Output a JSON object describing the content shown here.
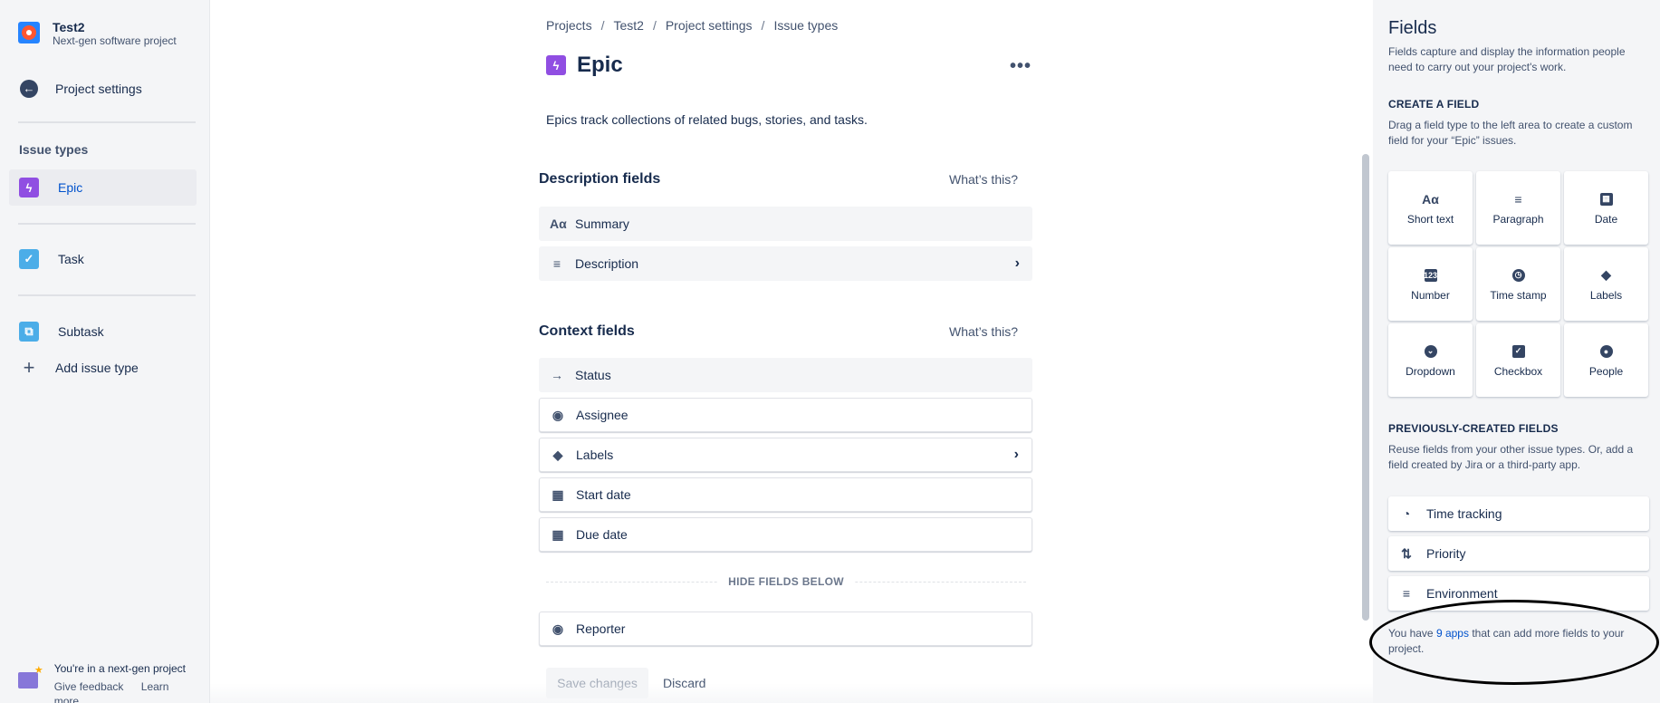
{
  "project": {
    "name": "Test2",
    "type": "Next-gen software project"
  },
  "sidebar": {
    "back_label": "Project settings",
    "issue_types_heading": "Issue types",
    "items": [
      {
        "label": "Epic",
        "icon": "epic-icon"
      },
      {
        "label": "Task",
        "icon": "task-icon"
      },
      {
        "label": "Subtask",
        "icon": "subtask-icon"
      }
    ],
    "add_label": "Add issue type",
    "footer": {
      "title": "You're in a next-gen project",
      "feedback": "Give feedback",
      "learn": "Learn more"
    }
  },
  "breadcrumbs": [
    "Projects",
    "Test2",
    "Project settings",
    "Issue types"
  ],
  "main": {
    "title": "Epic",
    "description": "Epics track collections of related bugs, stories, and tasks.",
    "description_section": {
      "heading": "Description fields",
      "help": "What’s this?"
    },
    "description_fields": [
      "Summary",
      "Description"
    ],
    "context_section": {
      "heading": "Context fields",
      "help": "What’s this?"
    },
    "context_fields": [
      "Status",
      "Assignee",
      "Labels",
      "Start date",
      "Due date"
    ],
    "hide_label": "HIDE FIELDS BELOW",
    "hidden_fields": [
      "Reporter"
    ],
    "save_label": "Save changes",
    "discard_label": "Discard"
  },
  "panel": {
    "title": "Fields",
    "intro": "Fields capture and display the information people need to carry out your project's work.",
    "create_heading": "CREATE A FIELD",
    "create_text": "Drag a field type to the left area to create a custom field for your “Epic” issues.",
    "field_types": [
      {
        "label": "Short text",
        "icon": "short-text-icon"
      },
      {
        "label": "Paragraph",
        "icon": "paragraph-icon"
      },
      {
        "label": "Date",
        "icon": "calendar-icon"
      },
      {
        "label": "Number",
        "icon": "number-icon"
      },
      {
        "label": "Time stamp",
        "icon": "clock-icon"
      },
      {
        "label": "Labels",
        "icon": "tag-icon"
      },
      {
        "label": "Dropdown",
        "icon": "dropdown-icon"
      },
      {
        "label": "Checkbox",
        "icon": "checkbox-icon"
      },
      {
        "label": "People",
        "icon": "person-icon"
      }
    ],
    "previous_heading": "PREVIOUSLY-CREATED FIELDS",
    "previous_text": "Reuse fields from your other issue types. Or, add a field created by Jira or a third-party app.",
    "previous_fields": [
      "Time tracking",
      "Priority",
      "Environment"
    ],
    "apps_note": {
      "before": "You have ",
      "link": "9 apps",
      "after": " that can add more fields to your project."
    }
  },
  "colors": {
    "epic": "#904EE2",
    "task": "#4BADE8",
    "link": "#0052CC",
    "text": "#172B4D"
  }
}
